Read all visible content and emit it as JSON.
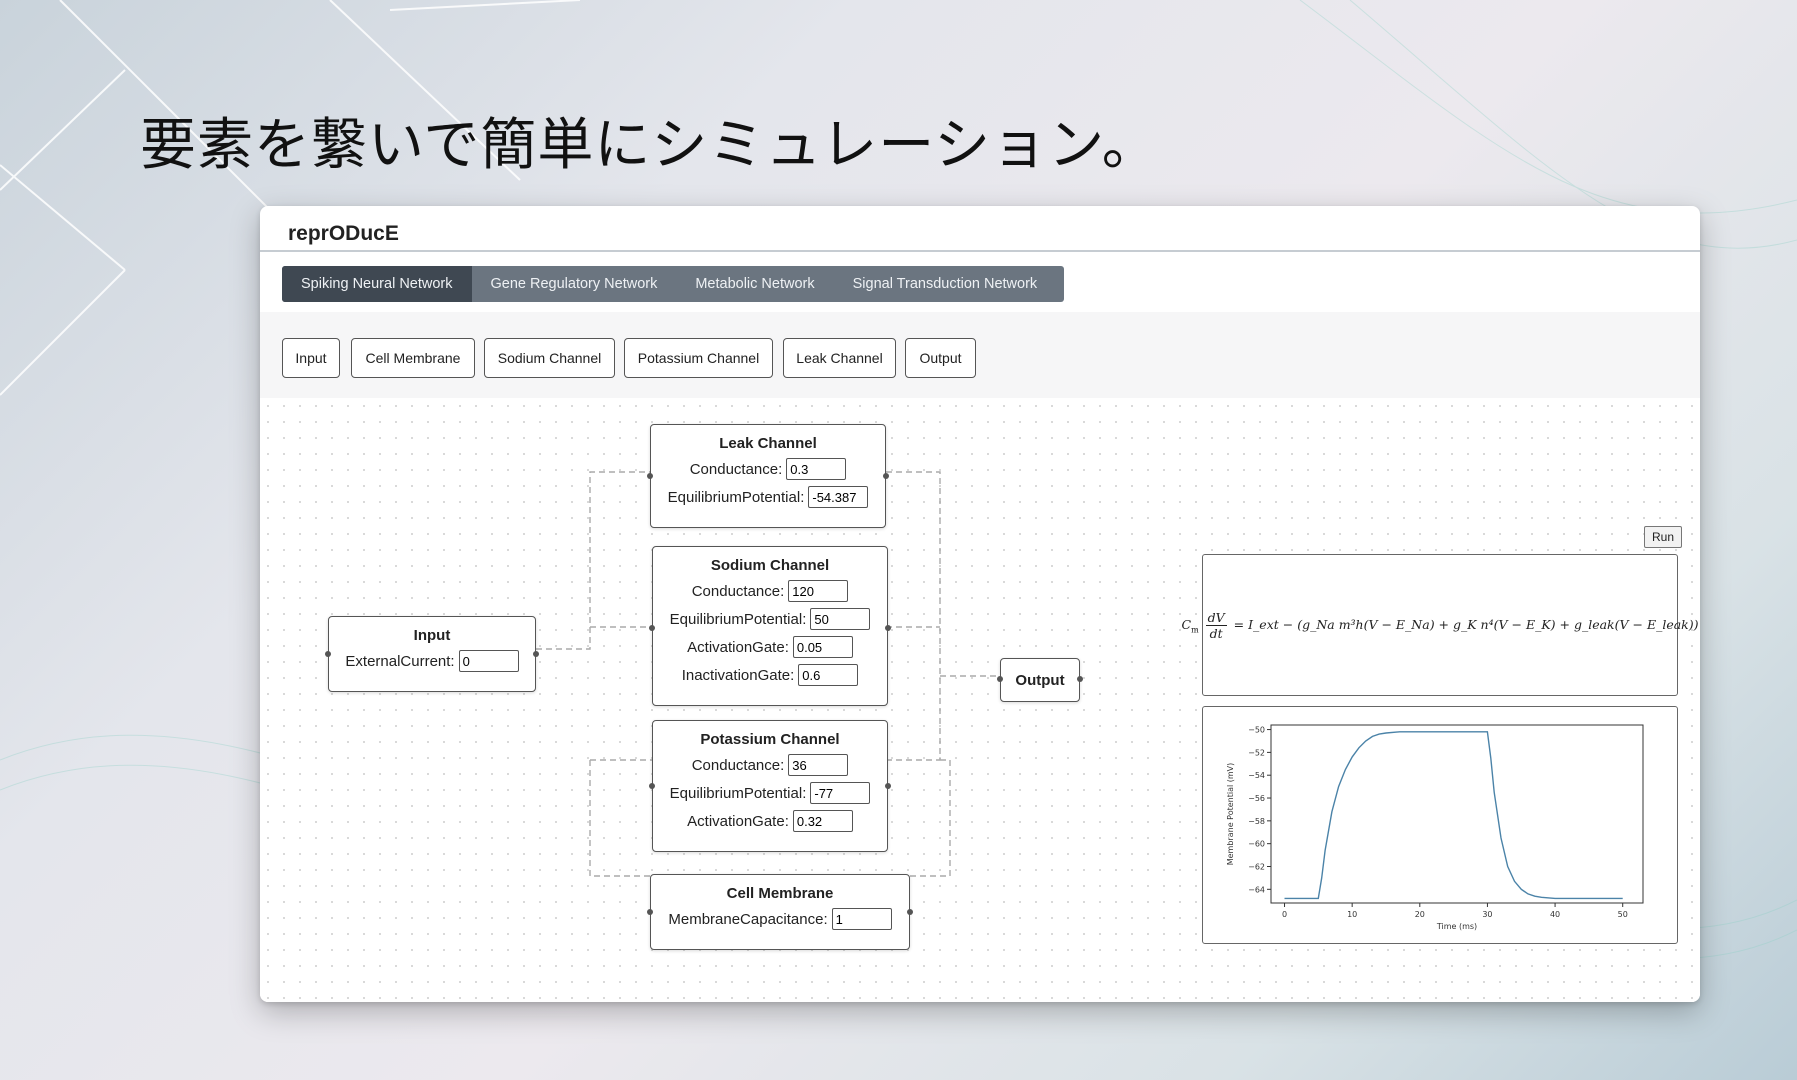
{
  "headline": "要素を繋いで簡単にシミュレーション。",
  "app_title": "reprODucE",
  "tabs": [
    {
      "label": "Spiking Neural Network",
      "active": true
    },
    {
      "label": "Gene Regulatory Network",
      "active": false
    },
    {
      "label": "Metabolic Network",
      "active": false
    },
    {
      "label": "Signal Transduction Network",
      "active": false
    }
  ],
  "palette": [
    "Input",
    "Cell Membrane",
    "Sodium Channel",
    "Potassium Channel",
    "Leak Channel",
    "Output"
  ],
  "nodes": {
    "leak": {
      "title": "Leak Channel",
      "fields": [
        {
          "label": "Conductance:",
          "value": "0.3"
        },
        {
          "label": "EquilibriumPotential:",
          "value": "-54.387"
        }
      ]
    },
    "sodium": {
      "title": "Sodium Channel",
      "fields": [
        {
          "label": "Conductance:",
          "value": "120"
        },
        {
          "label": "EquilibriumPotential:",
          "value": "50"
        },
        {
          "label": "ActivationGate:",
          "value": "0.05"
        },
        {
          "label": "InactivationGate:",
          "value": "0.6"
        }
      ]
    },
    "potassium": {
      "title": "Potassium Channel",
      "fields": [
        {
          "label": "Conductance:",
          "value": "36"
        },
        {
          "label": "EquilibriumPotential:",
          "value": "-77"
        },
        {
          "label": "ActivationGate:",
          "value": "0.32"
        }
      ]
    },
    "membrane": {
      "title": "Cell Membrane",
      "fields": [
        {
          "label": "MembraneCapacitance:",
          "value": "1"
        }
      ]
    },
    "input": {
      "title": "Input",
      "fields": [
        {
          "label": "ExternalCurrent:",
          "value": "0"
        }
      ]
    },
    "output": {
      "title": "Output"
    }
  },
  "run_label": "Run",
  "equation": {
    "lhs_coef": "C",
    "lhs_coef_sub": "m",
    "frac_num": "dV",
    "frac_den": "dt",
    "rhs": "= I_ext − (g_Na m³h(V − E_Na) + g_K n⁴(V − E_K) + g_leak(V − E_leak))"
  },
  "chart_data": {
    "type": "line",
    "xlabel": "Time (ms)",
    "ylabel": "Membrane Potential (mV)",
    "xlim": [
      -2,
      53
    ],
    "ylim": [
      -65.2,
      -49.6
    ],
    "xticks": [
      0,
      10,
      20,
      30,
      40,
      50
    ],
    "yticks": [
      -50,
      -52,
      -54,
      -56,
      -58,
      -60,
      -62,
      -64
    ],
    "color": "#4b83a8",
    "series": [
      {
        "x": [
          0,
          5,
          5.5,
          6,
          7,
          8,
          9,
          10,
          11,
          12,
          13,
          14,
          15,
          17,
          20,
          25,
          30,
          30.5,
          31,
          32,
          33,
          34,
          35,
          36,
          37,
          38,
          40,
          43,
          47,
          50
        ],
        "values": [
          -64.8,
          -64.8,
          -63.0,
          -60.6,
          -57.2,
          -55.0,
          -53.5,
          -52.4,
          -51.6,
          -51.0,
          -50.6,
          -50.4,
          -50.3,
          -50.2,
          -50.2,
          -50.2,
          -50.2,
          -52.5,
          -55.5,
          -59.5,
          -62.0,
          -63.3,
          -64.0,
          -64.4,
          -64.6,
          -64.7,
          -64.8,
          -64.8,
          -64.8,
          -64.8
        ]
      }
    ]
  }
}
